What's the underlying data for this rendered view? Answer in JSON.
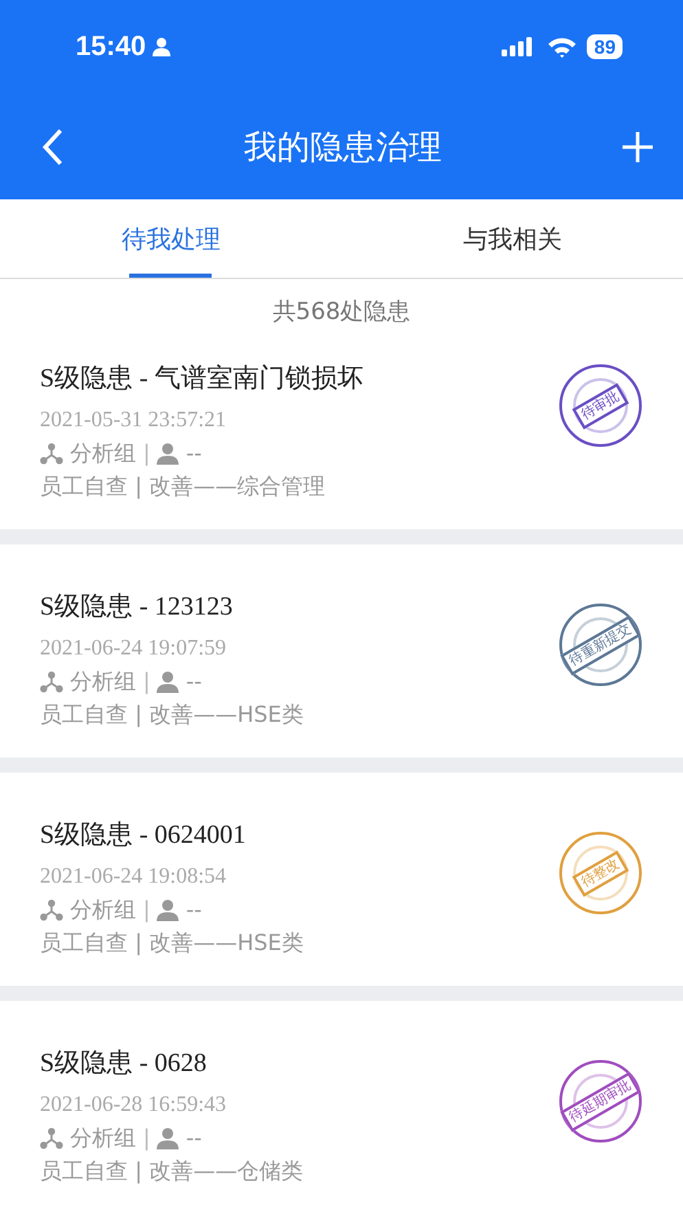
{
  "status_bar": {
    "time": "15:40",
    "battery": "89"
  },
  "header": {
    "title": "我的隐患治理"
  },
  "tabs": [
    {
      "label": "待我处理",
      "selected": true
    },
    {
      "label": "与我相关",
      "selected": false
    }
  ],
  "summary": "共568处隐患",
  "hazards": [
    {
      "title": "S级隐患 - 气谱室南门锁损坏",
      "time": "2021-05-31 23:57:21",
      "group": "分析组",
      "separator": "|",
      "person": "--",
      "category": "员工自查 | 改善——综合管理",
      "status": "待审批",
      "color": "#6a4fc4"
    },
    {
      "title": "S级隐患 - 123123",
      "time": "2021-06-24 19:07:59",
      "group": "分析组",
      "separator": "|",
      "person": "--",
      "category": "员工自查 | 改善——HSE类",
      "status": "待重新提交",
      "color": "#5d7896"
    },
    {
      "title": "S级隐患 - 0624001",
      "time": "2021-06-24 19:08:54",
      "group": "分析组",
      "separator": "|",
      "person": "--",
      "category": "员工自查 | 改善——HSE类",
      "status": "待整改",
      "color": "#e0a040"
    },
    {
      "title": "S级隐患 - 0628",
      "time": "2021-06-28 16:59:43",
      "group": "分析组",
      "separator": "|",
      "person": "--",
      "category": "员工自查 | 改善——仓储类",
      "status": "待延期审批",
      "color": "#a04dbf"
    }
  ]
}
